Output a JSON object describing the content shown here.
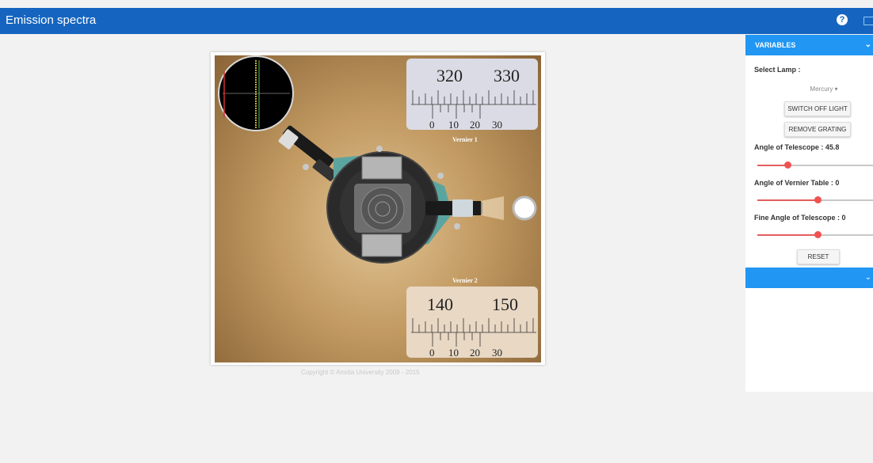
{
  "header": {
    "title": "Emission spectra",
    "help_icon": "?"
  },
  "simulation": {
    "vernier1": {
      "label": "Vernier 1",
      "main_left": "320",
      "main_right": "330",
      "sub": [
        "0",
        "10",
        "20",
        "30"
      ]
    },
    "vernier2": {
      "label": "Vernier 2",
      "main_left": "140",
      "main_right": "150",
      "sub": [
        "0",
        "10",
        "20",
        "30"
      ]
    },
    "copyright": "Copyright © Amrita University 2009 - 2015"
  },
  "panel": {
    "header": "VARIABLES",
    "select_lamp_label": "Select Lamp :",
    "lamp_value": "Mercury",
    "switch_button": "SWITCH OFF LIGHT",
    "grating_button": "REMOVE GRATING",
    "telescope_label": "Angle of Telescope : 45.8",
    "telescope_fraction": 0.26,
    "vernier_table_label": "Angle of Vernier Table : 0",
    "vernier_table_fraction": 0.52,
    "fine_label": "Fine Angle of Telescope : 0",
    "fine_fraction": 0.52,
    "reset_button": "RESET"
  },
  "colors": {
    "topbar": "#1565c0",
    "panel_header": "#2196f3",
    "slider": "#ef5350"
  }
}
